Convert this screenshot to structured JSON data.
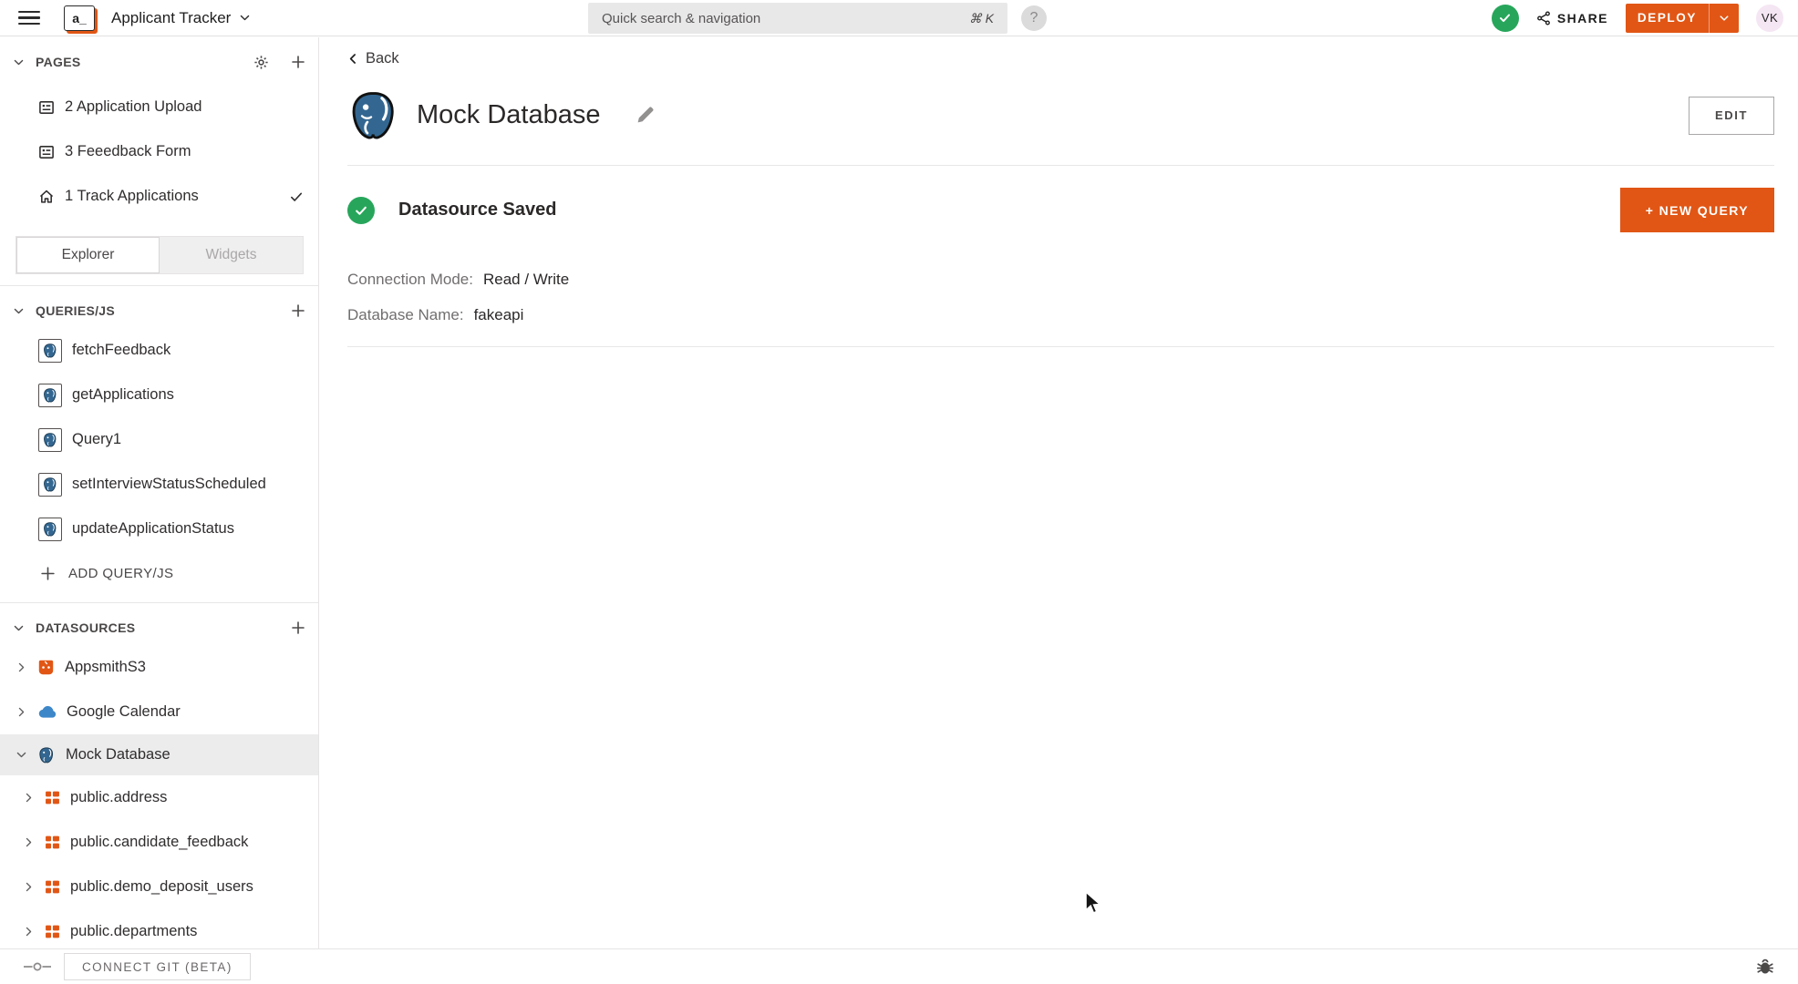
{
  "topbar": {
    "logo_text": "a_",
    "app_title": "Applicant Tracker",
    "search_placeholder": "Quick search & navigation",
    "search_shortcut": "⌘ K",
    "help_label": "?",
    "share_label": "SHARE",
    "deploy_label": "DEPLOY",
    "avatar_initials": "VK"
  },
  "sidebar": {
    "pages": {
      "header": "PAGES",
      "items": [
        {
          "label": "2 Application Upload",
          "icon": "page-icon",
          "checked": false
        },
        {
          "label": "3 Feeedback Form",
          "icon": "page-icon",
          "checked": false
        },
        {
          "label": "1 Track Applications",
          "icon": "home-icon",
          "checked": true
        }
      ]
    },
    "tabs": {
      "explorer": "Explorer",
      "widgets": "Widgets"
    },
    "queries": {
      "header": "QUERIES/JS",
      "items": [
        "fetchFeedback",
        "getApplications",
        "Query1",
        "setInterviewStatusScheduled",
        "updateApplicationStatus"
      ],
      "add_label": "ADD QUERY/JS"
    },
    "datasources": {
      "header": "DATASOURCES",
      "items": [
        {
          "label": "AppsmithS3",
          "icon": "appsmith-icon"
        },
        {
          "label": "Google Calendar",
          "icon": "cloud-icon"
        },
        {
          "label": "Mock Database",
          "icon": "postgres-icon",
          "selected": true,
          "expanded": true
        }
      ],
      "tables": [
        "public.address",
        "public.candidate_feedback",
        "public.demo_deposit_users",
        "public.departments"
      ]
    },
    "footer": {
      "connect_git_label": "CONNECT GIT (BETA)"
    }
  },
  "main": {
    "back_label": "Back",
    "title": "Mock Database",
    "edit_label": "EDIT",
    "status_label": "Datasource Saved",
    "new_query_label": "+ NEW QUERY",
    "fields": [
      {
        "label": "Connection Mode:",
        "value": "Read / Write"
      },
      {
        "label": "Database Name:",
        "value": "fakeapi"
      }
    ]
  },
  "colors": {
    "accent_orange": "#E15615",
    "success_green": "#27A65B",
    "topbar_bg": "#FFFFFF",
    "selected_row_bg": "#ECECEC"
  }
}
